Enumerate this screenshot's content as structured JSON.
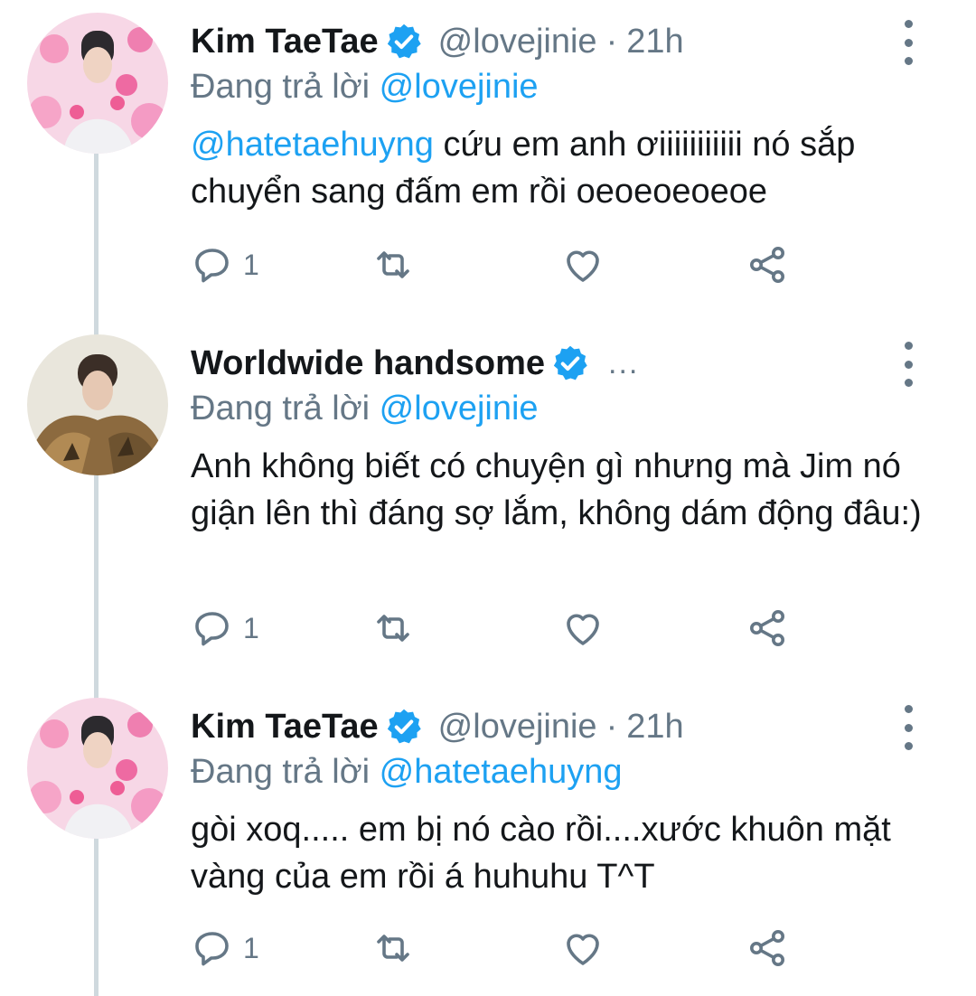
{
  "tweets": [
    {
      "display_name": "Kim TaeTae",
      "handle": "@lovejinie",
      "separator": "·",
      "time": "21h",
      "truncated_marker": "",
      "reply_prefix": "Đang trả lời",
      "reply_to": "@lovejinie",
      "body_mention": "@hatetaehuyng",
      "body_text": " cứu em anh ơiiiiiiiiiii nó sắp chuyển sang đấm em rồi oeoeoeoeoe",
      "reply_count": "1",
      "avatar_icon": "avatar-taetae-icon"
    },
    {
      "display_name": "Worldwide handsome",
      "handle": "",
      "separator": "",
      "time": "",
      "truncated_marker": "...",
      "reply_prefix": "Đang trả lời",
      "reply_to": "@lovejinie",
      "body_mention": "",
      "body_text": "Anh không biết có chuyện gì nhưng mà Jim nó giận lên thì đáng sợ lắm, không dám động đâu:)",
      "reply_count": "1",
      "avatar_icon": "avatar-fur-coat-icon"
    },
    {
      "display_name": "Kim TaeTae",
      "handle": "@lovejinie",
      "separator": "·",
      "time": "21h",
      "truncated_marker": "",
      "reply_prefix": "Đang trả lời",
      "reply_to": "@hatetaehuyng",
      "body_mention": "",
      "body_text": "gòi xoq..... em bị nó cào rồi....xước khuôn mặt vàng của em rồi á huhuhu T^T",
      "reply_count": "1",
      "avatar_icon": "avatar-taetae-icon"
    }
  ],
  "colors": {
    "accent": "#1da1f2",
    "secondary_text": "#657786",
    "primary_text": "#14171a",
    "thread_line": "#cfd9de"
  },
  "icons": [
    "verified-badge-icon",
    "more-vertical-icon",
    "reply-icon",
    "retweet-icon",
    "like-icon",
    "share-icon"
  ]
}
